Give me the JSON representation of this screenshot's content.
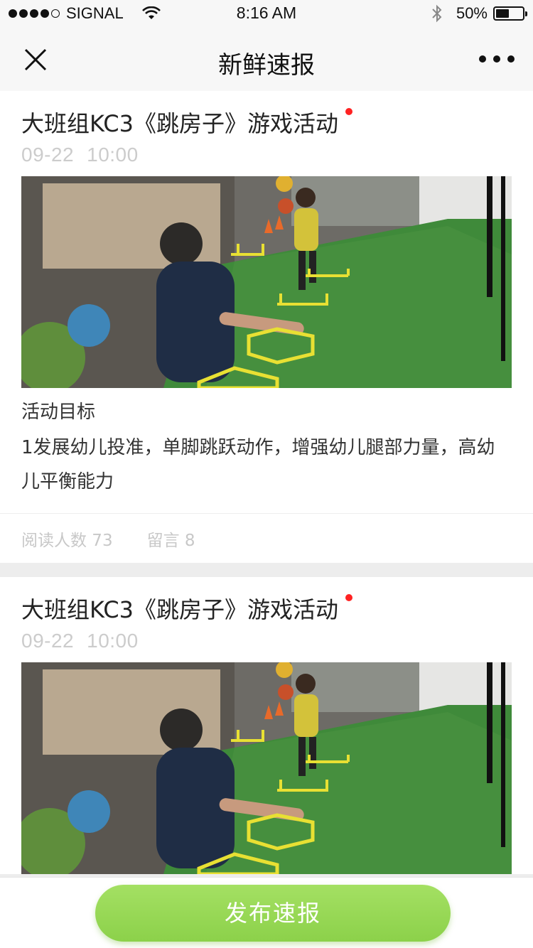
{
  "status_bar": {
    "carrier": "SIGNAL",
    "time": "8:16 AM",
    "battery_percent_label": "50%",
    "battery_level": 0.5
  },
  "nav": {
    "title": "新鲜速报",
    "close_icon": "close-icon",
    "more_icon": "more-icon"
  },
  "posts": [
    {
      "title": "大班组KC3《跳房子》游戏活动",
      "unread": true,
      "date": "09-22",
      "time": "10:00",
      "goal_label": "活动目标",
      "goal_text": "1发展幼儿投准，单脚跳跃动作，增强幼儿腿部力量，高幼儿平衡能力",
      "reads_label": "阅读人数 73",
      "comments_label": "留言 8"
    },
    {
      "title": "大班组KC3《跳房子》游戏活动",
      "unread": true,
      "date": "09-22",
      "time": "10:00"
    }
  ],
  "publish_button": "发布速报",
  "colors": {
    "accent_green": "#8cd14a",
    "unread_dot": "#ff2222",
    "turf": "#3f8a3a"
  }
}
